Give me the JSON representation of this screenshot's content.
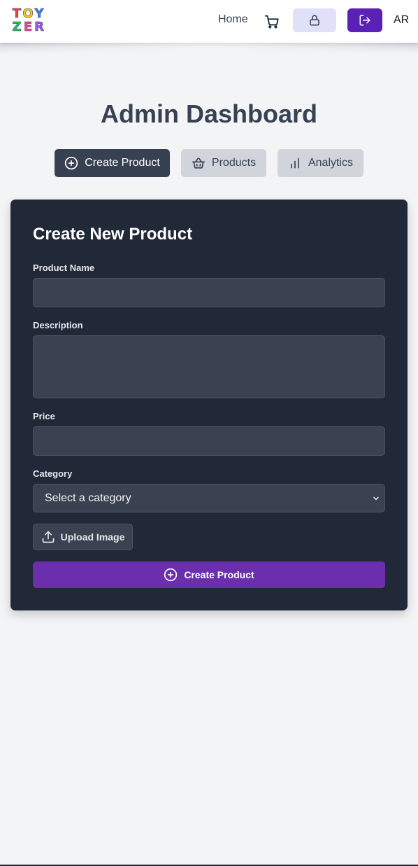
{
  "header": {
    "logo": {
      "row1": [
        {
          "char": "T",
          "color": "#ef4444"
        },
        {
          "char": "O",
          "color": "#facc15"
        },
        {
          "char": "Y",
          "color": "#3b82f6"
        }
      ],
      "row2": [
        {
          "char": "Z",
          "color": "#22c55e"
        },
        {
          "char": "E",
          "color": "#ec4899"
        },
        {
          "char": "R",
          "color": "#a855f7"
        }
      ]
    },
    "home_label": "Home",
    "cart_icon": "shopping-cart-icon",
    "lock_icon": "lock-icon",
    "logout_icon": "logout-icon",
    "lang_label": "AR"
  },
  "page_title": "Admin Dashboard",
  "tabs": [
    {
      "label": "Create Product",
      "icon": "plus-circle-icon",
      "active": true
    },
    {
      "label": "Products",
      "icon": "basket-icon",
      "active": false
    },
    {
      "label": "Analytics",
      "icon": "bar-chart-icon",
      "active": false
    }
  ],
  "form": {
    "title": "Create New Product",
    "fields": {
      "name": {
        "label": "Product Name",
        "value": ""
      },
      "description": {
        "label": "Description",
        "value": ""
      },
      "price": {
        "label": "Price",
        "value": ""
      },
      "category": {
        "label": "Category",
        "selected": "Select a category"
      }
    },
    "upload_label": "Upload Image",
    "submit_label": "Create Product"
  },
  "colors": {
    "brand_purple": "#5b21b6",
    "card_bg": "#212837",
    "input_bg": "#3a4150",
    "active_tab_bg": "#374151",
    "inactive_tab_bg": "#d1d5db"
  }
}
